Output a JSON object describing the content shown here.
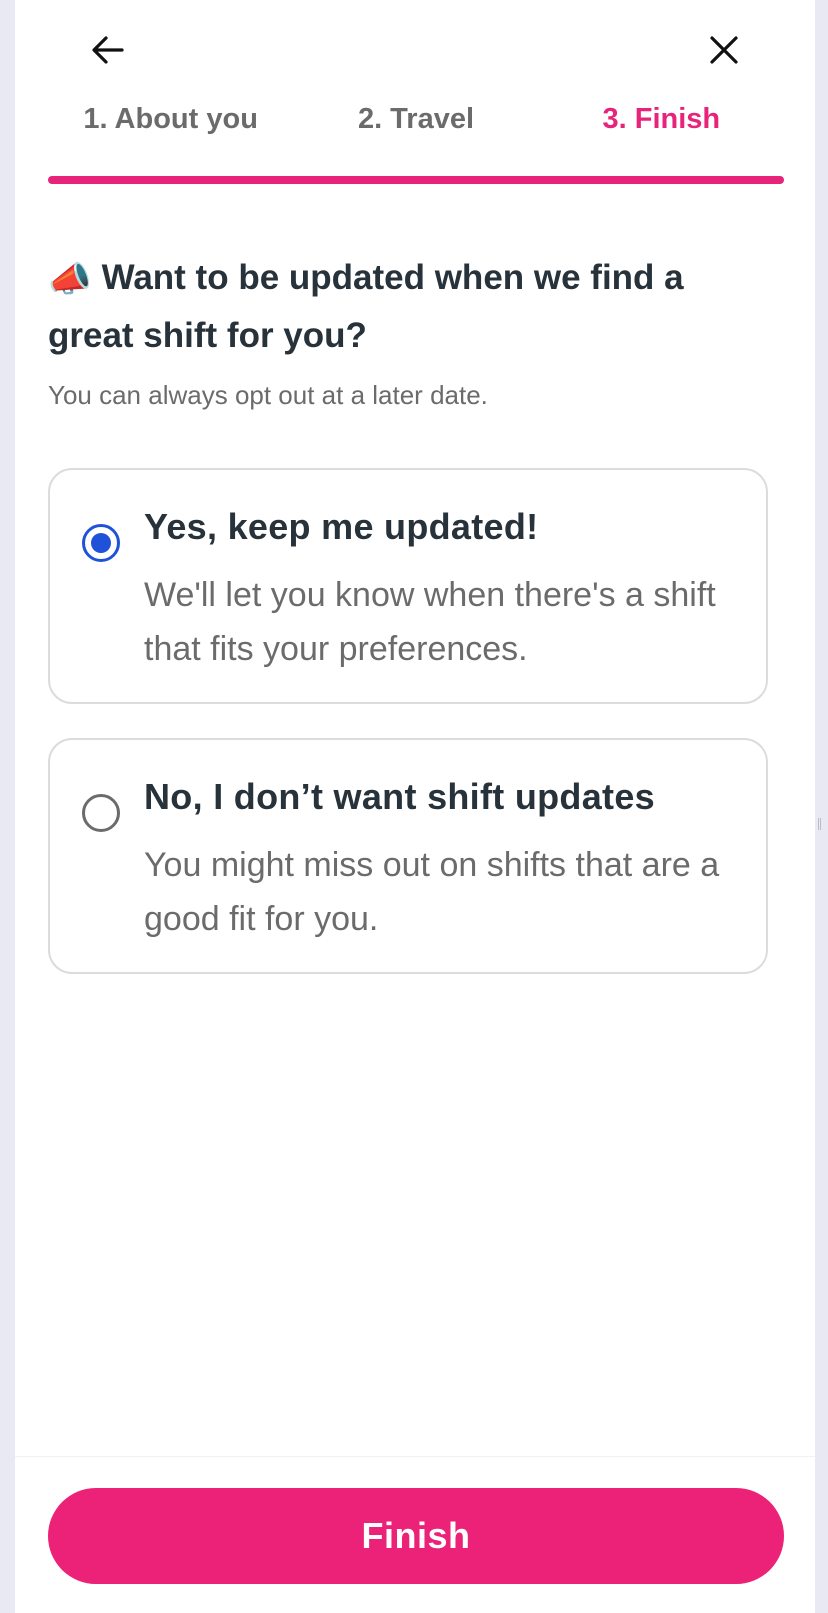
{
  "header": {
    "back_icon": "arrow-left-icon",
    "close_icon": "close-icon"
  },
  "steps": [
    {
      "label": "1. About you",
      "active": false
    },
    {
      "label": "2. Travel",
      "active": false
    },
    {
      "label": "3. Finish",
      "active": true
    }
  ],
  "progress": {
    "value": 1.0,
    "color": "#e8247a"
  },
  "question": {
    "emoji": "📣",
    "title": "Want to be updated when we find a great shift for you?",
    "subtitle": "You can always opt out at a later date."
  },
  "options": [
    {
      "title": "Yes, keep me updated!",
      "description": "We'll let you know when there's a shift that fits your preferences.",
      "selected": true
    },
    {
      "title": "No, I don’t want shift updates",
      "description": "You might miss out on shifts that are a good fit for you.",
      "selected": false
    }
  ],
  "footer": {
    "finish_label": "Finish"
  },
  "colors": {
    "accent": "#e8247a",
    "radio": "#1f52d8",
    "text": "#27323a",
    "muted": "#6b6b6b"
  }
}
